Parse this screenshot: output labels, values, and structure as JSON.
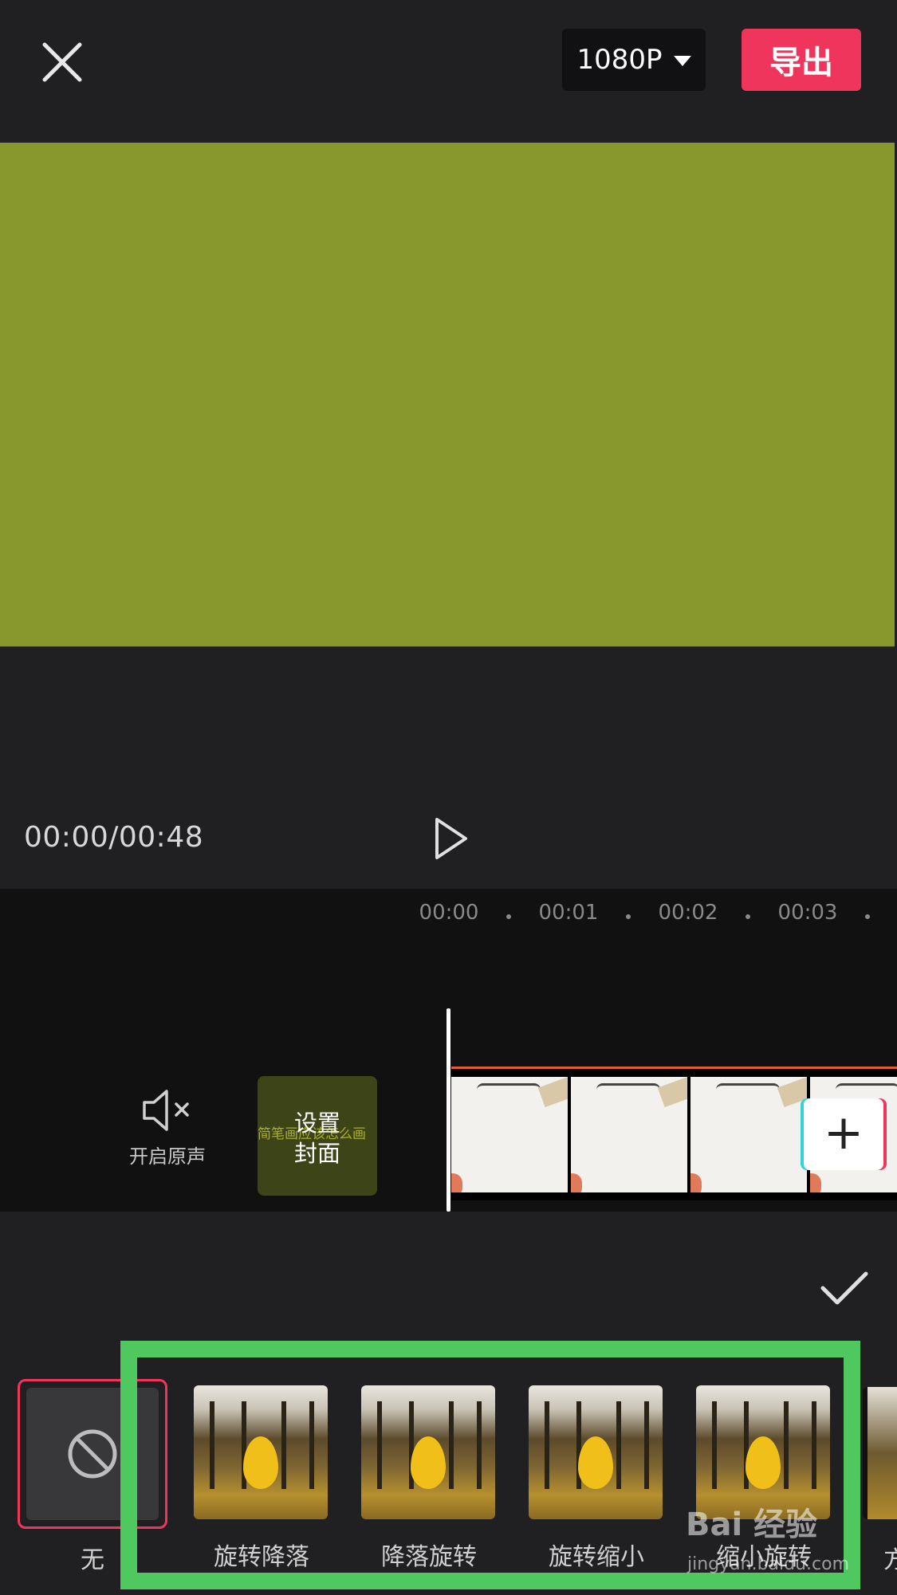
{
  "topbar": {
    "resolution": "1080P",
    "export_label": "导出"
  },
  "preview": {
    "color": "#88982c"
  },
  "playback": {
    "time": "00:00/00:48"
  },
  "timeline": {
    "ruler": [
      "00:00",
      "00:01",
      "00:02",
      "00:03"
    ],
    "mute_label": "开启原声",
    "cover_label_line1": "设置",
    "cover_label_line2": "封面",
    "cover_overlay_text": "简笔画应该怎么画"
  },
  "animations": {
    "none_label": "无",
    "items": [
      {
        "label": "旋转降落"
      },
      {
        "label": "降落旋转"
      },
      {
        "label": "旋转缩小"
      },
      {
        "label": "缩小旋转"
      }
    ],
    "partial_label": "方"
  },
  "watermark": {
    "brand": "Bai 经验",
    "url": "jingyan.baidu.com"
  },
  "colors": {
    "accent": "#f0355c",
    "highlight": "#4fc85f"
  }
}
